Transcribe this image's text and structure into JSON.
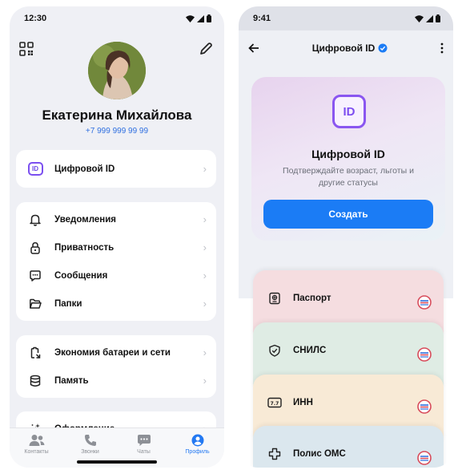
{
  "left": {
    "status": {
      "time": "12:30"
    },
    "profile": {
      "name": "Екатерина Михайлова",
      "phone": "+7 999 999 99 99"
    },
    "digital_id": {
      "label": "Цифровой ID",
      "icon_text": "ID"
    },
    "menu_group_1": [
      {
        "label": "Уведомления",
        "icon": "bell-icon"
      },
      {
        "label": "Приватность",
        "icon": "lock-icon"
      },
      {
        "label": "Сообщения",
        "icon": "chat-bubble-icon"
      },
      {
        "label": "Папки",
        "icon": "folder-icon"
      }
    ],
    "menu_group_2": [
      {
        "label": "Экономия батареи и сети",
        "icon": "battery-saver-icon"
      },
      {
        "label": "Память",
        "icon": "storage-icon"
      }
    ],
    "menu_group_3": [
      {
        "label": "Оформление",
        "icon": "appearance-icon"
      }
    ],
    "tabs": [
      {
        "label": "Контакты",
        "icon": "contacts-icon"
      },
      {
        "label": "Звонки",
        "icon": "phone-icon"
      },
      {
        "label": "Чаты",
        "icon": "chats-icon"
      },
      {
        "label": "Профиль",
        "icon": "profile-icon",
        "active": true
      }
    ]
  },
  "right": {
    "status": {
      "time": "9:41"
    },
    "header": {
      "title": "Цифровой ID"
    },
    "hero": {
      "icon_text": "ID",
      "title": "Цифровой ID",
      "subtitle": "Подтверждайте возраст, льготы и другие статусы",
      "button_label": "Создать"
    },
    "documents": [
      {
        "label": "Паспорт",
        "icon": "passport-icon",
        "color": "#f5dde0"
      },
      {
        "label": "СНИЛС",
        "icon": "shield-check-icon",
        "color": "#dfece4"
      },
      {
        "label": "ИНН",
        "icon": "inn-card-icon",
        "color": "#f8ead6"
      },
      {
        "label": "Полис ОМС",
        "icon": "medical-cross-icon",
        "color": "#dbe7ee"
      }
    ]
  },
  "colors": {
    "accent": "#1b7cf5",
    "id_purple": "#8a56f0",
    "phone_link": "#2f6fe0"
  }
}
